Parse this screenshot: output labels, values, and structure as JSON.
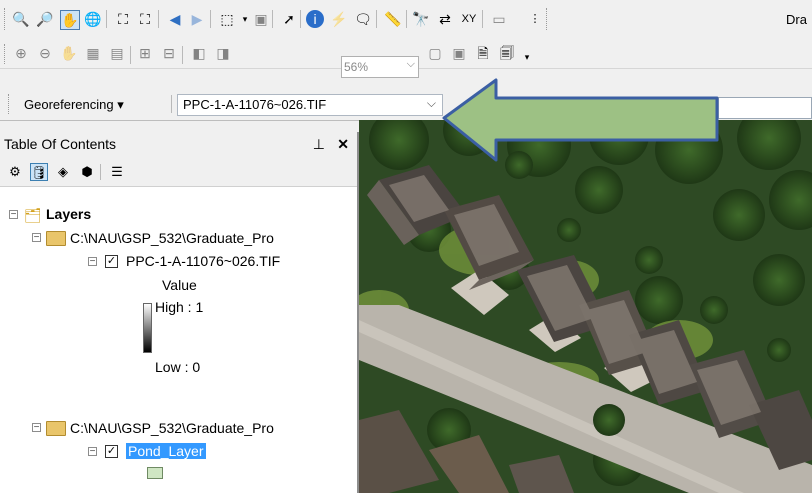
{
  "toolbar1": {
    "icons": [
      "zoom-in-icon",
      "zoom-out-icon",
      "pan-icon",
      "full-extent-icon",
      "fixed-zoom-in-icon",
      "fixed-zoom-out-icon",
      "back-extent-icon",
      "forward-extent-icon",
      "select-features-icon",
      "clear-selection-icon",
      "select-elements-icon",
      "identify-icon",
      "hyperlink-icon",
      "html-popup-icon",
      "measure-icon",
      "find-icon",
      "find-route-icon",
      "go-to-xy-icon",
      "time-slider-icon"
    ],
    "draw_label": "Dra"
  },
  "toolbar2": {
    "zoom_value": "56%"
  },
  "georef": {
    "menu_label": "Georeferencing ▾",
    "layer_value": "PPC-1-A-11076~026.TIF"
  },
  "toc": {
    "title": "Table Of Contents",
    "pin": "⊥",
    "close": "✕",
    "root_label": "Layers",
    "groups": [
      {
        "path": "C:\\NAU\\GSP_532\\Graduate_Pro",
        "layer": "PPC-1-A-11076~026.TIF",
        "value_label": "Value",
        "high_label": "High : 1",
        "low_label": "Low : 0"
      },
      {
        "path": "C:\\NAU\\GSP_532\\Graduate_Pro",
        "layer": "Pond_Layer"
      }
    ]
  },
  "colors": {
    "arrow_fill": "#9dc184",
    "arrow_stroke": "#3b5fa3",
    "selection": "#3399ff"
  }
}
